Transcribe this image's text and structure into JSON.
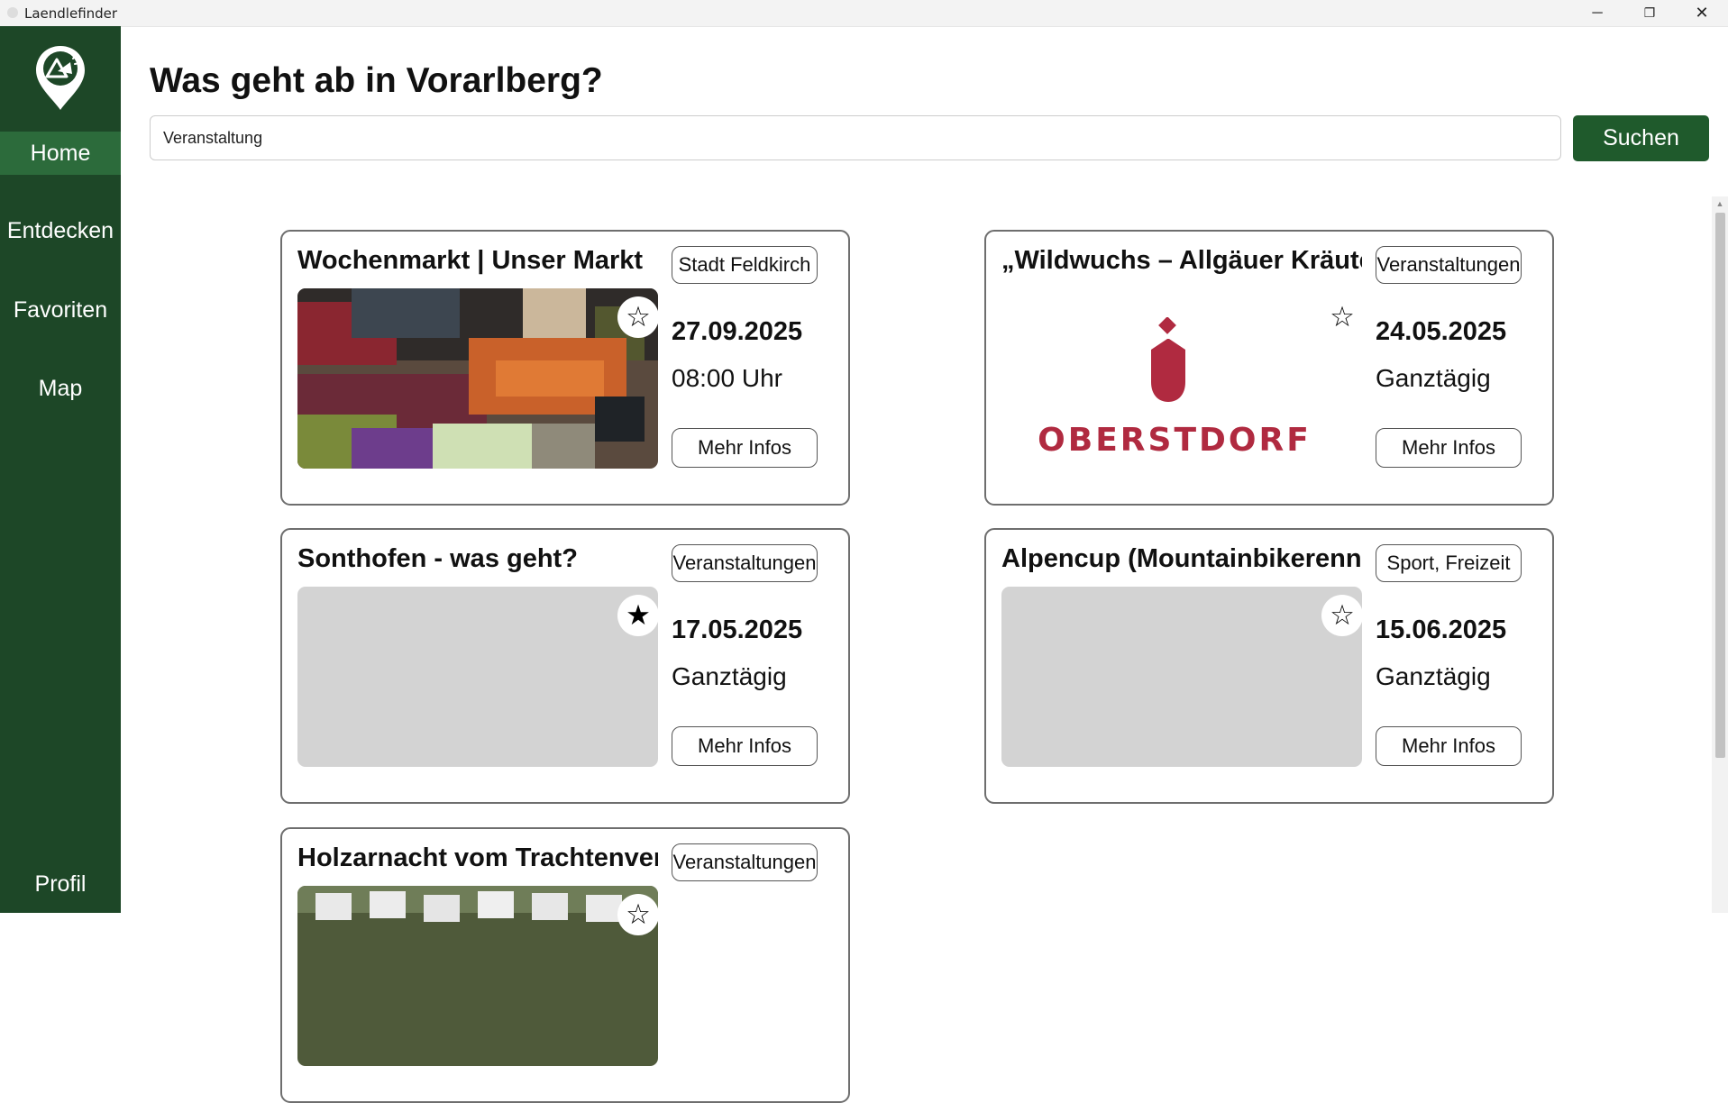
{
  "window": {
    "title": "Laendlefinder"
  },
  "nav": {
    "items": [
      {
        "label": "Home"
      },
      {
        "label": "Entdecken"
      },
      {
        "label": "Favoriten"
      },
      {
        "label": "Map"
      }
    ],
    "profile": "Profil"
  },
  "header": {
    "title": "Was geht ab in Vorarlberg?"
  },
  "search": {
    "value": "Veranstaltung",
    "button": "Suchen"
  },
  "cards": [
    {
      "title": "Wochenmarkt | Unser Markt",
      "tag": "Stadt Feldkirch",
      "date": "27.09.2025",
      "time": "08:00 Uhr",
      "more": "Mehr Infos",
      "favorite": false,
      "fav_icon": "star-outline"
    },
    {
      "title": "„Wildwuchs – Allgäuer Kräuter",
      "tag": "Veranstaltungen",
      "date": "24.05.2025",
      "time": "Ganztägig",
      "more": "Mehr Infos",
      "favorite": false,
      "fav_icon": "star-outline",
      "logo_text": "OBERSTDORF"
    },
    {
      "title": "Sonthofen - was geht?",
      "tag": "Veranstaltungen",
      "date": "17.05.2025",
      "time": "Ganztägig",
      "more": "Mehr Infos",
      "favorite": true,
      "fav_icon": "star-filled"
    },
    {
      "title": "Alpencup (Mountainbikerennen",
      "tag": "Sport, Freizeit",
      "date": "15.06.2025",
      "time": "Ganztägig",
      "more": "Mehr Infos",
      "favorite": false,
      "fav_icon": "star-outline"
    },
    {
      "title": "Holzarnacht vom Trachtenverein",
      "tag": "Veranstaltungen",
      "favorite": false,
      "fav_icon": "star-outline"
    }
  ],
  "colors": {
    "sidebar": "#1d4727",
    "nav_active": "#2c6b3b",
    "accent": "#1f5a2c",
    "logo_red": "#b02a40"
  }
}
